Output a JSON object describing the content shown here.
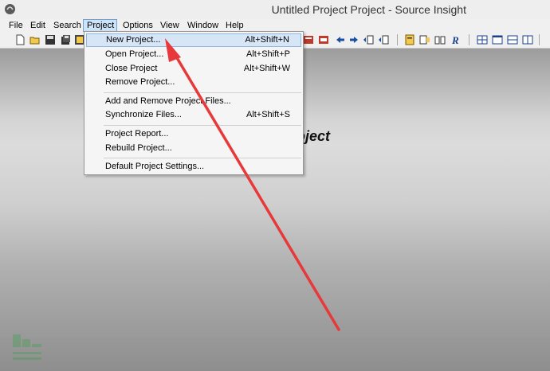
{
  "window": {
    "title": "Untitled Project Project - Source Insight"
  },
  "menubar": {
    "items": [
      "File",
      "Edit",
      "Search",
      "Project",
      "Options",
      "View",
      "Window",
      "Help"
    ],
    "active": "Project"
  },
  "workspace": {
    "heading": "oject"
  },
  "project_menu": {
    "items": [
      {
        "label": "New Project...",
        "shortcut": "Alt+Shift+N",
        "highlighted": true
      },
      {
        "label": "Open Project...",
        "shortcut": "Alt+Shift+P"
      },
      {
        "label": "Close Project",
        "shortcut": "Alt+Shift+W"
      },
      {
        "label": "Remove Project...",
        "shortcut": ""
      },
      {
        "label": "Add and Remove Project Files...",
        "shortcut": ""
      },
      {
        "label": "Synchronize Files...",
        "shortcut": "Alt+Shift+S"
      },
      {
        "label": "Project Report...",
        "shortcut": ""
      },
      {
        "label": "Rebuild Project...",
        "shortcut": ""
      },
      {
        "label": "Default Project Settings...",
        "shortcut": ""
      }
    ]
  },
  "colors": {
    "annotation_arrow": "#e8393a",
    "menu_highlight": "#d6e6f7"
  },
  "icons": {
    "toolbar": [
      "new-file-icon",
      "open-folder-icon",
      "save-icon",
      "save-all-icon",
      "close-file-icon",
      "bookmark-icon",
      "jump-back-icon",
      "jump-forward-icon",
      "symbol-window-icon",
      "relation-window-icon",
      "lookup-icon",
      "context-icon",
      "browse-icon",
      "layout-icon",
      "window-tile-icon"
    ]
  }
}
